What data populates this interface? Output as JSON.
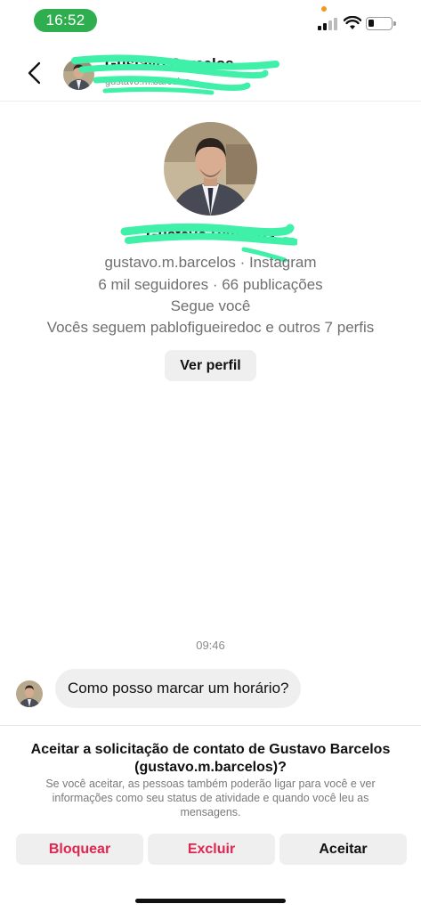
{
  "status_bar": {
    "time": "16:52",
    "time_pill_color": "#2fae4f",
    "icons": [
      "signal-icon",
      "wifi-icon",
      "battery-icon"
    ]
  },
  "header": {
    "name": "Gustavo Barcelos",
    "subtitle": "gustavo.m.barcelos",
    "icons": [
      "back-arrow-icon"
    ]
  },
  "profile": {
    "name": "Gustavo Barcelos",
    "username_source": "gustavo.m.barcelos · Instagram",
    "stats": "6 mil seguidores · 66 publicações",
    "follows_you": "Segue você",
    "mutuals": "Vocês seguem pablofigueiredoc e outros 7 perfis",
    "view_profile_button": "Ver perfil"
  },
  "conversation": {
    "timestamp": "09:46",
    "messages": [
      {
        "text": "Como posso marcar um horário?"
      }
    ]
  },
  "request_panel": {
    "title": "Aceitar a solicitação de contato de Gustavo Barcelos (gustavo.m.barcelos)?",
    "description": "Se você aceitar, as pessoas também poderão ligar para você e ver informações como seu status de atividade e quando você leu as mensagens.",
    "buttons": {
      "block": "Bloquear",
      "delete": "Excluir",
      "accept": "Aceitar"
    },
    "colors": {
      "destructive": "#e0254f",
      "neutral": "#111111"
    }
  },
  "redaction_color": "#3ef0a8"
}
